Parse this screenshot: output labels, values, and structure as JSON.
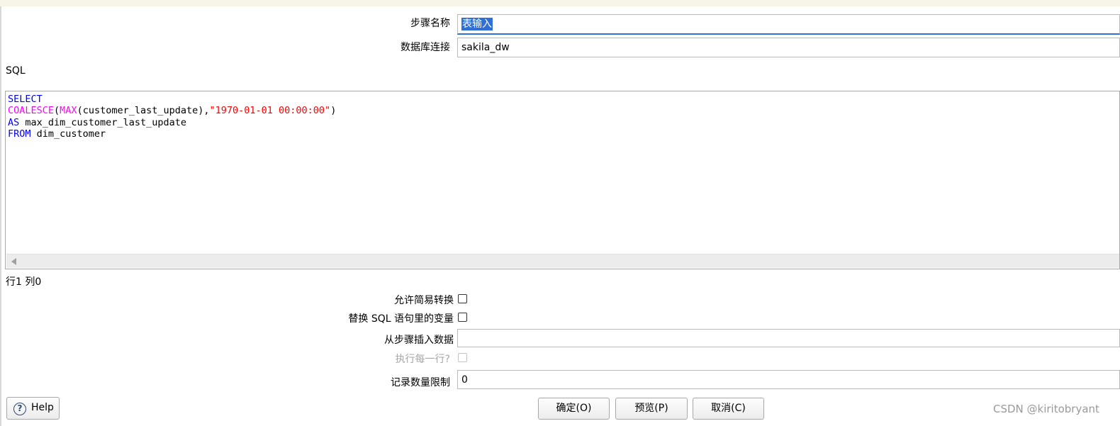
{
  "form": {
    "step_name_label": "步骤名称",
    "step_name_value": "表输入",
    "db_connection_label": "数据库连接",
    "db_connection_value": "sakila_dw",
    "sql_label": "SQL"
  },
  "sql_editor": {
    "lines": [
      [
        {
          "t": "SELECT",
          "c": "kw"
        }
      ],
      [
        {
          "t": "COALESCE",
          "c": "fn"
        },
        {
          "t": "(",
          "c": ""
        },
        {
          "t": "MAX",
          "c": "fn"
        },
        {
          "t": "(customer_last_update),",
          "c": ""
        },
        {
          "t": "\"1970-01-01 00:00:00\"",
          "c": "str"
        },
        {
          "t": ")",
          "c": ""
        }
      ],
      [
        {
          "t": "AS",
          "c": "kw"
        },
        {
          "t": " max_dim_customer_last_update",
          "c": ""
        }
      ],
      [
        {
          "t": "FROM",
          "c": "kw"
        },
        {
          "t": " dim_customer",
          "c": ""
        }
      ]
    ],
    "cursor_position": "行1 列0"
  },
  "options": {
    "lazy_conversion_label": "允许简易转换",
    "lazy_conversion_checked": false,
    "replace_variables_label": "替换 SQL 语句里的变量",
    "replace_variables_checked": false,
    "insert_from_step_label": "从步骤插入数据",
    "insert_from_step_value": "",
    "execute_each_row_label": "执行每一行?",
    "execute_each_row_checked": false,
    "limit_label": "记录数量限制",
    "limit_value": "0"
  },
  "buttons": {
    "help": "Help",
    "ok": "确定(O)",
    "preview": "预览(P)",
    "cancel": "取消(C)"
  },
  "watermark": "CSDN @kiritobryant",
  "colors": {
    "keyword": "#0000ff",
    "function": "#ff00ff",
    "string": "#ff0000",
    "selection": "#2f6fd6"
  },
  "icons": {
    "help": "question-circle-icon",
    "scroll_left": "arrow-left-icon"
  }
}
